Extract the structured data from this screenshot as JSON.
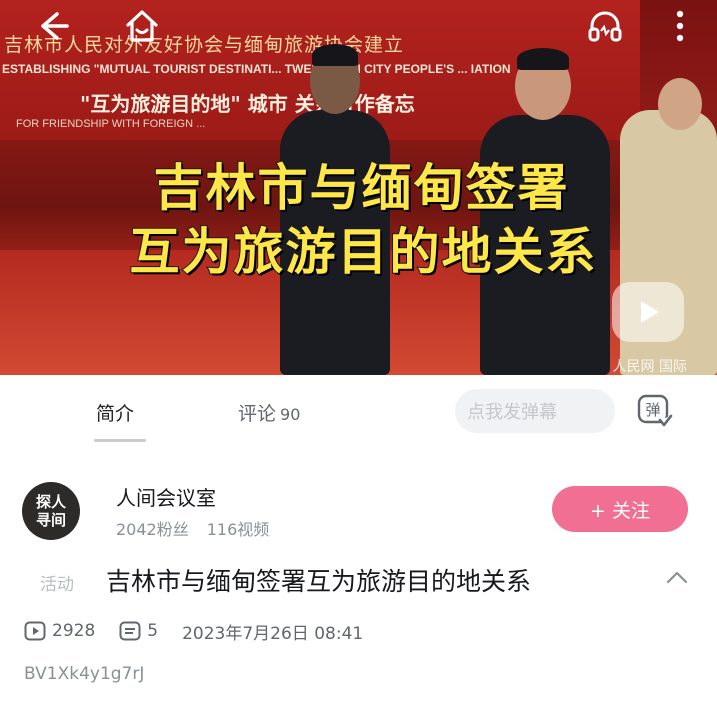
{
  "video": {
    "banner_line1": "吉林市人民对外友好协会与缅甸旅游协会建立",
    "banner_line2": "ESTABLISHING \"MUTUAL TOURIST DESTINATI... TWEEN JILIN CITY PEOPLE'S ... IATION",
    "banner_line3": "\"互为旅游目的地\" 城市 关系合作备忘",
    "banner_line4": "FOR FRIENDSHIP WITH FOREIGN ...",
    "headline_line1": "吉林市与缅甸签署",
    "headline_line2": "互为旅游目的地关系",
    "watermark": "人民网 国际"
  },
  "icons": {
    "back": "back-arrow-icon",
    "home": "home-icon",
    "audio": "headphones-icon",
    "more": "more-vertical-icon",
    "play": "play-icon"
  },
  "tabs": {
    "intro": "简介",
    "comments": "评论",
    "comments_count": "90",
    "danmaku_placeholder": "点我发弹幕",
    "danmaku_toggle": "弹"
  },
  "uploader": {
    "avatar_text_line1": "探人",
    "avatar_text_line2": "寻间",
    "name": "人间会议室",
    "followers": "2042粉丝",
    "videos": "116视频",
    "follow_label": "+ 关注"
  },
  "details": {
    "tag": "活动",
    "title": "吉林市与缅甸签署互为旅游目的地关系",
    "plays": "2928",
    "danmaku_count": "5",
    "date": "2023年7月26日 08:41",
    "bvid": "BV1Xk4y1g7rJ"
  },
  "colors": {
    "accent_pink": "#f06f93",
    "headline_yellow": "#ffe74a",
    "banner_red": "#b3221e"
  }
}
